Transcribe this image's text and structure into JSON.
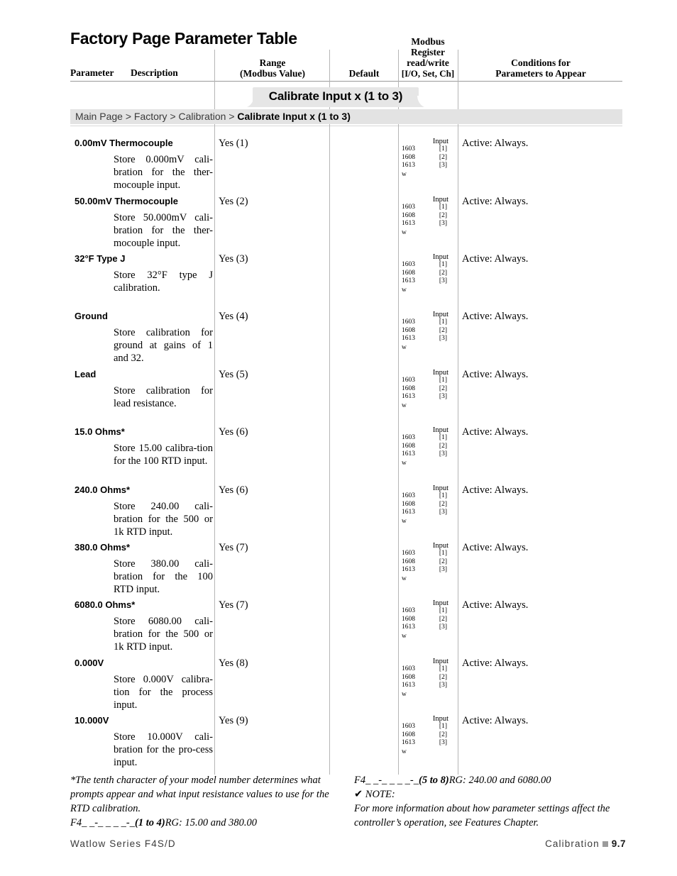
{
  "title": "Factory Page Parameter Table",
  "table_headers": {
    "parameter": "Parameter",
    "description": "Description",
    "range_l1": "Range",
    "range_l2": "(Modbus Value)",
    "default": "Default",
    "modbus_l1": "Modbus",
    "modbus_l2": "Register",
    "modbus_l3": "read/write",
    "modbus_l4": "[I/O, Set, Ch]",
    "conditions_l1": "Conditions for",
    "conditions_l2": "Parameters to Appear"
  },
  "section_tab": "Calibrate Input x (1 to 3)",
  "breadcrumb": {
    "trail": "Main Page > Factory > Calibration > ",
    "current": "Calibrate Input x (1 to 3)"
  },
  "modbus_block": {
    "head": "Input",
    "registers": [
      "1603",
      "1608",
      "1613"
    ],
    "channels": [
      "[1]",
      "[2]",
      "[3]"
    ],
    "readwrite": "w"
  },
  "rows": [
    {
      "name": "0.00mV Thermocouple",
      "description": "Store 0.000mV cali-bration for the ther-mocouple input.",
      "range": "Yes (1)",
      "default": "",
      "conditions": "Active: Always."
    },
    {
      "name": "50.00mV Thermocouple",
      "description": "Store 50.000mV cali-bration for the ther-mocouple input.",
      "range": "Yes (2)",
      "default": "",
      "conditions": "Active: Always."
    },
    {
      "name": "32°F Type J",
      "description": "Store 32°F type J calibration.",
      "range": "Yes (3)",
      "default": "",
      "conditions": "Active: Always."
    },
    {
      "name": "Ground",
      "description": "Store calibration for ground at gains of 1 and 32.",
      "range": "Yes (4)",
      "default": "",
      "conditions": "Active: Always."
    },
    {
      "name": "Lead",
      "description": "Store calibration for lead resistance.",
      "range": "Yes (5)",
      "default": "",
      "conditions": "Active: Always."
    },
    {
      "name": "15.0 Ohms*",
      "description": "Store 15.00   calibra-tion for the 100  RTD input.",
      "range": "Yes (6)",
      "default": "",
      "conditions": "Active: Always."
    },
    {
      "name": "240.0 Ohms*",
      "description": "Store 240.00   cali-bration for the 500  or 1k   RTD input.",
      "range": "Yes (6)",
      "default": "",
      "conditions": "Active: Always."
    },
    {
      "name": "380.0 Ohms*",
      "description": "Store 380.00   cali-bration for the 100  RTD input.",
      "range": "Yes (7)",
      "default": "",
      "conditions": "Active: Always."
    },
    {
      "name": "6080.0 Ohms*",
      "description": "Store 6080.00   cali-bration for the 500  or 1k   RTD input.",
      "range": "Yes (7)",
      "default": "",
      "conditions": "Active: Always."
    },
    {
      "name": "0.000V",
      "description": "Store 0.000V calibra-tion for the process input.",
      "range": "Yes (8)",
      "default": "",
      "conditions": "Active: Always."
    },
    {
      "name": "10.000V",
      "description": "Store 10.000V cali-bration for the pro-cess input.",
      "range": "Yes (9)",
      "default": "",
      "conditions": "Active: Always."
    }
  ],
  "footnotes": {
    "left_paragraph": "*The tenth character of your model number determines what prompts appear and what input resistance values to use for the RTD calibration.",
    "left_model_prefix": "F4_ _-_ _ _ _-_",
    "left_model_bold": "(1 to 4)",
    "left_model_suffix": "RG:  15.00 and 380.00",
    "right_model_prefix": "F4_ _-_ _ _ _-_",
    "right_model_bold": "(5 to 8)",
    "right_model_suffix": "RG:  240.00 and 6080.00",
    "note_label": "NOTE:",
    "note_body": "For more information about how parameter settings affect the controller’s operation, see Features Chapter."
  },
  "footer": {
    "left": "Watlow Series F4S/D",
    "right_label": "Calibration",
    "page_number": "9.7"
  }
}
